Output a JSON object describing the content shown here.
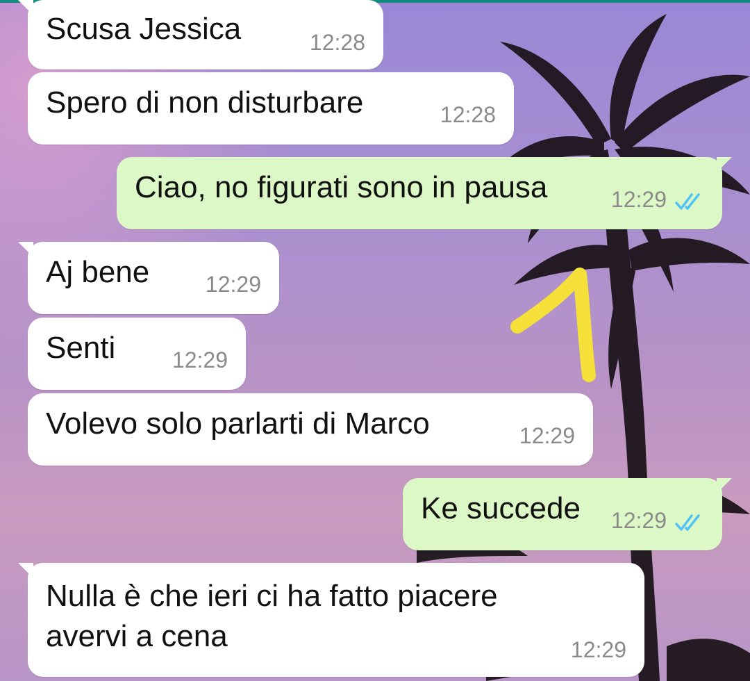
{
  "messages": [
    {
      "text": "Scusa Jessica",
      "time": "12:28",
      "direction": "incoming"
    },
    {
      "text": "Spero di non disturbare",
      "time": "12:28",
      "direction": "incoming"
    },
    {
      "text": "Ciao, no figurati sono in pausa",
      "time": "12:29",
      "direction": "outgoing",
      "status": "read"
    },
    {
      "text": "Aj bene",
      "time": "12:29",
      "direction": "incoming"
    },
    {
      "text": "Senti",
      "time": "12:29",
      "direction": "incoming"
    },
    {
      "text": "Volevo solo parlarti di Marco",
      "time": "12:29",
      "direction": "incoming"
    },
    {
      "text": "Ke succede",
      "time": "12:29",
      "direction": "outgoing",
      "status": "read"
    },
    {
      "text_line1": "Nulla è che ieri ci ha fatto piacere",
      "text_line2": "avervi a cena",
      "time": "12:29",
      "direction": "incoming"
    }
  ],
  "colors": {
    "incoming_bubble": "#ffffff",
    "outgoing_bubble": "#dcf8c6",
    "read_ticks": "#4fc3f7",
    "annotation": "#f5e13a"
  },
  "icons": {
    "read_receipt": "double-check-icon"
  }
}
